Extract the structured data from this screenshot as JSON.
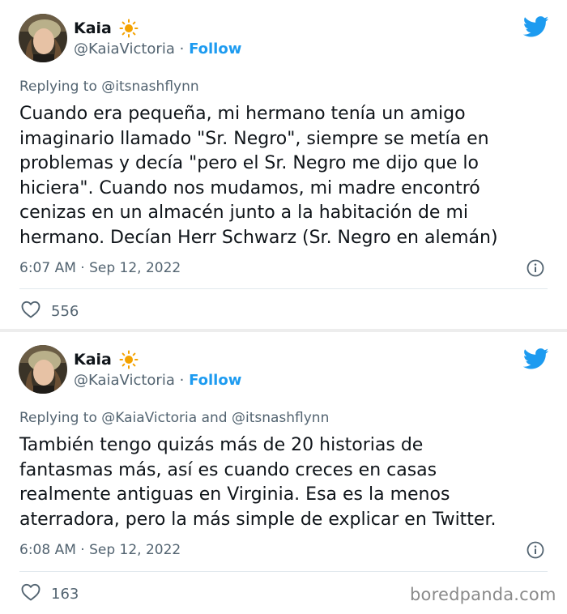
{
  "tweets": [
    {
      "display_name": "Kaia",
      "handle": "@KaiaVictoria",
      "separator": "·",
      "follow_label": "Follow",
      "replying_to": "Replying to @itsnashflynn",
      "text": "Cuando era pequeña, mi hermano tenía un amigo\nimaginario llamado \"Sr. Negro\", siempre se metía en\nproblemas y decía \"pero el Sr. Negro me dijo que lo\nhiciera\". Cuando nos mudamos, mi madre encontró\ncenizas en un almacén junto a la habitación de mi\nhermano. Decían Herr Schwarz (Sr. Negro en alemán)",
      "timestamp": "6:07 AM · Sep 12, 2022",
      "likes": "556"
    },
    {
      "display_name": "Kaia",
      "handle": "@KaiaVictoria",
      "separator": "·",
      "follow_label": "Follow",
      "replying_to": "Replying to @KaiaVictoria and @itsnashflynn",
      "text": "También tengo quizás más de 20 historias de\nfantasmas más, así es cuando creces en casas\nrealmente antiguas en Virginia. Esa es la menos\naterradora, pero la más simple de explicar en Twitter.",
      "timestamp": "6:08 AM · Sep 12, 2022",
      "likes": "163"
    }
  ],
  "icons": {
    "verified_emoji": "sun-icon",
    "platform": "twitter-bird-icon",
    "info": "info-icon",
    "like": "heart-icon"
  },
  "colors": {
    "accent": "#1d9bf0",
    "secondary_text": "#536471",
    "primary_text": "#0f1419",
    "sun": "#f4a200"
  },
  "watermark": "boredpanda.com"
}
